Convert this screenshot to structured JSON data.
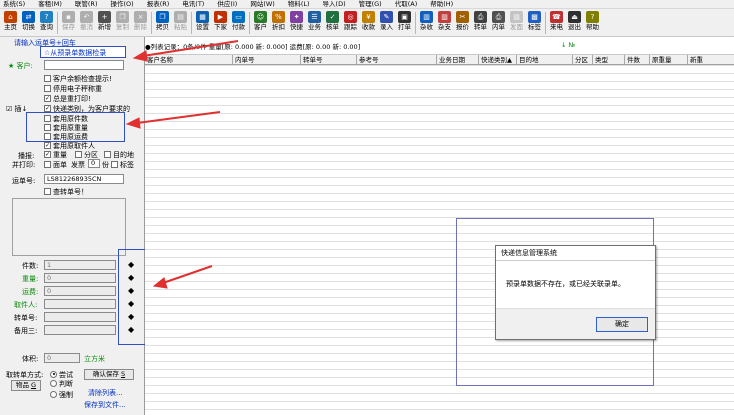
{
  "menu": [
    "系统(S)",
    "客租(M)",
    "联管(R)",
    "操作(O)",
    "报表(R)",
    "电讯(T)",
    "供应(I)",
    "网站(W)",
    "物料(L)",
    "导入(D)",
    "管理(G)",
    "代取(A)",
    "帮助(H)"
  ],
  "toolbar": {
    "buttons": [
      {
        "label": "主页",
        "icon": "home-icon",
        "color": "#c04000",
        "glyph": "⌂",
        "enabled": true
      },
      {
        "label": "切换",
        "icon": "switch-icon",
        "color": "#0060c0",
        "glyph": "⇄",
        "enabled": true
      },
      {
        "label": "查询",
        "icon": "query-icon",
        "color": "#2080c0",
        "glyph": "?",
        "enabled": true
      },
      {
        "label": "保存",
        "icon": "save-icon",
        "color": "#606060",
        "glyph": "▪",
        "enabled": false
      },
      {
        "label": "撤消",
        "icon": "undo-icon",
        "color": "#606060",
        "glyph": "↶",
        "enabled": false
      },
      {
        "label": "新增",
        "icon": "new-icon",
        "color": "#505050",
        "glyph": "+",
        "enabled": true
      },
      {
        "label": "复制",
        "icon": "copy-icon",
        "color": "#606060",
        "glyph": "❐",
        "enabled": false
      },
      {
        "label": "删除",
        "icon": "delete-icon",
        "color": "#606060",
        "glyph": "×",
        "enabled": false
      },
      {
        "label": "拷贝",
        "icon": "copy-icon",
        "color": "#0060c0",
        "glyph": "❐",
        "enabled": true
      },
      {
        "label": "粘贴",
        "icon": "paste-icon",
        "color": "#606060",
        "glyph": "▤",
        "enabled": false
      },
      {
        "label": "设置",
        "icon": "settings-icon",
        "color": "#1060b0",
        "glyph": "▦",
        "enabled": true
      },
      {
        "label": "下家",
        "icon": "next-party-icon",
        "color": "#c03000",
        "glyph": "▶",
        "enabled": true
      },
      {
        "label": "付款",
        "icon": "payment-icon",
        "color": "#0070c0",
        "glyph": "▭",
        "enabled": true
      },
      {
        "label": "客户",
        "icon": "customer-icon",
        "color": "#2a7a2a",
        "glyph": "☺",
        "enabled": true
      },
      {
        "label": "折扣",
        "icon": "discount-icon",
        "color": "#c07000",
        "glyph": "%",
        "enabled": true
      },
      {
        "label": "快捷",
        "icon": "shortcut-icon",
        "color": "#8040a0",
        "glyph": "✦",
        "enabled": true
      },
      {
        "label": "业务",
        "icon": "business-icon",
        "color": "#2060a0",
        "glyph": "☰",
        "enabled": true
      },
      {
        "label": "核单",
        "icon": "verify-icon",
        "color": "#207040",
        "glyph": "✓",
        "enabled": true
      },
      {
        "label": "跟踪",
        "icon": "track-icon",
        "color": "#c02020",
        "glyph": "◎",
        "enabled": true
      },
      {
        "label": "收款",
        "icon": "receive-icon",
        "color": "#c08000",
        "glyph": "¥",
        "enabled": true
      },
      {
        "label": "录入",
        "icon": "entry-icon",
        "color": "#3050b0",
        "glyph": "✎",
        "enabled": true
      },
      {
        "label": "打单",
        "icon": "print-icon",
        "color": "#303030",
        "glyph": "▣",
        "enabled": true
      },
      {
        "label": "杂收",
        "icon": "misc-income-icon",
        "color": "#1060c0",
        "glyph": "▥",
        "enabled": true
      },
      {
        "label": "杂支",
        "icon": "misc-expense-icon",
        "color": "#c04040",
        "glyph": "▥",
        "enabled": true
      },
      {
        "label": "报价",
        "icon": "quote-icon",
        "color": "#a06000",
        "glyph": "✂",
        "enabled": true
      },
      {
        "label": "转单",
        "icon": "transfer-icon",
        "color": "#404040",
        "glyph": "⎙",
        "enabled": true
      },
      {
        "label": "内单",
        "icon": "internal-icon",
        "color": "#505050",
        "glyph": "⎙",
        "enabled": true
      },
      {
        "label": "发面",
        "icon": "dispatch-icon",
        "color": "#909090",
        "glyph": "▧",
        "enabled": false
      },
      {
        "label": "标签",
        "icon": "label-icon",
        "color": "#2060c0",
        "glyph": "▩",
        "enabled": true
      },
      {
        "label": "来电",
        "icon": "phone-icon",
        "color": "#c03030",
        "glyph": "☎",
        "enabled": true
      },
      {
        "label": "退出",
        "icon": "exit-icon",
        "color": "#303030",
        "glyph": "⏏",
        "enabled": true
      },
      {
        "label": "帮助",
        "icon": "help-icon",
        "color": "#808000",
        "glyph": "?",
        "enabled": true
      }
    ]
  },
  "left": {
    "top_label": "请输入运单号+回车",
    "link_label": "☆从预录单数据检录",
    "customer_label": "客户:",
    "opt_balance": "客户余额检查提示!",
    "opt_e_weight": "停用电子秤称重",
    "opt_always_print": "总是重打印!",
    "opt_express_type": "快递类别，为客户要求的",
    "opt_orig_pieces": "套用原件数",
    "opt_orig_weight": "套用原重量",
    "opt_orig_freight": "套用原运费",
    "opt_orig_sender": "套用原取件人",
    "side_label": "☑ 插↓",
    "broadcast_label": "播报:",
    "bc_weight": "重量",
    "bc_zone": "分区",
    "bc_dest": "目的地",
    "print_label": "并打印:",
    "pr_face": "面单",
    "pr_invoice": "发票",
    "pr_copies_value": "0",
    "pr_copies_unit": "份",
    "pr_label": "标签",
    "waybill_label": "运单号:",
    "waybill_value": "LS812268935CN",
    "query_transfer": "查转单号！",
    "pieces_label": "件数:",
    "pieces_value": "1",
    "weight_label": "重量:",
    "weight_value": "0",
    "freight_label": "运费:",
    "freight_value": "0",
    "sender_label": "取件人:",
    "transfer_no_label": "转单号:",
    "remark3_label": "备用三:",
    "volume_label": "体积:",
    "volume_value": "0",
    "volume_unit": "立方米",
    "mode_label": "取转单方式:",
    "mode_try": "尝试",
    "mode_judge": "判断",
    "mode_force": "强制",
    "confirm_save": "确认保存",
    "confirm_key": "S",
    "goods_label": "物品",
    "goods_key": "G",
    "clear_list": "清除列表...",
    "save_file": "保存到文件..."
  },
  "grid": {
    "status_text": "●列表记录：0条/0件 重量[原: 0.000 新: 0.000] 运费[原: 0.00 新: 0.00]",
    "status_indicator": "↓ №",
    "columns": [
      "客户名称",
      "内单号",
      "转单号",
      "参考号",
      "业务日期",
      "快递类别▲",
      "目的地",
      "分区",
      "类型",
      "件数",
      "原重量",
      "新重"
    ]
  },
  "dialog": {
    "title": "快递信息管理系统",
    "message": "预录单数据不存在，或已经关联录单。",
    "ok": "确定"
  },
  "colors": {
    "arrow": "#e03030",
    "highlight_border": "#3050c0"
  }
}
